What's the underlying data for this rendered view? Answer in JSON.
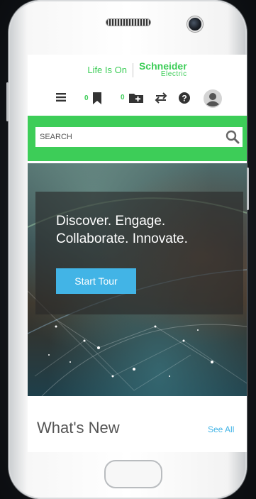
{
  "brand": {
    "tagline": "Life Is On",
    "company_line1": "Schneider",
    "company_line2": "Electric"
  },
  "icon_bar": {
    "bookmarks_count": "0",
    "folders_count": "0"
  },
  "search": {
    "placeholder": "SEARCH"
  },
  "hero": {
    "line1": "Discover. Engage.",
    "line2": "Collaborate. Innovate.",
    "button_label": "Start Tour"
  },
  "whats_new": {
    "title": "What's New",
    "see_all": "See All"
  },
  "colors": {
    "brand_green": "#3dcd58",
    "accent_blue": "#42b4e6"
  },
  "icons": [
    "menu-icon",
    "bookmark-icon",
    "add-folder-icon",
    "swap-icon",
    "help-icon",
    "user-avatar-icon",
    "search-icon"
  ]
}
